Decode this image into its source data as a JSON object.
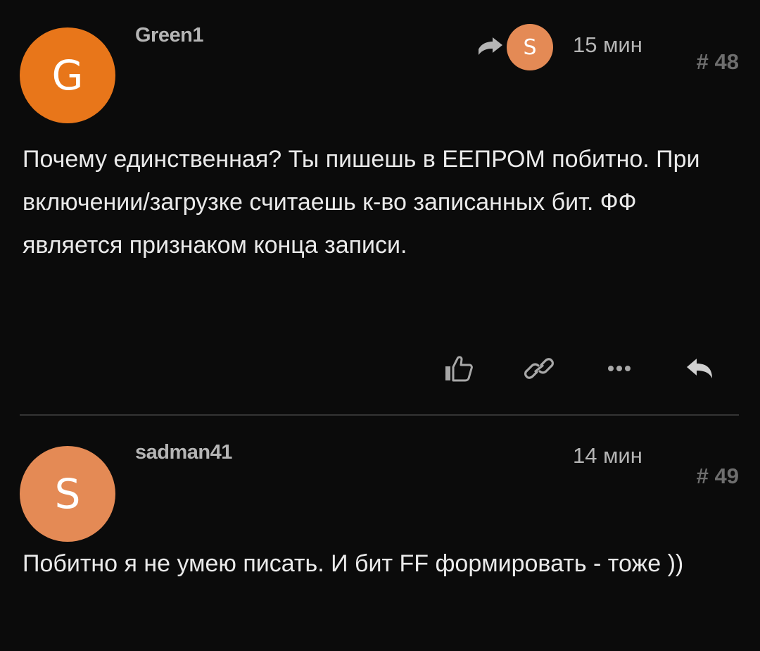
{
  "posts": [
    {
      "avatar_letter": "G",
      "avatar_color": "#e8761a",
      "username": "Green1",
      "reply_to_avatar_letter": "S",
      "time": "15 мин",
      "post_number": "# 48",
      "text": "Почему единственная? Ты пишешь в ЕЕПРОМ побитно. При включении/загрузке считаешь к-во записанных бит. ФФ является признаком конца записи.",
      "actions": [
        "like-icon",
        "link-icon",
        "more-icon",
        "reply-icon"
      ]
    },
    {
      "avatar_letter": "S",
      "avatar_color": "#e48a55",
      "username": "sadman41",
      "time": "14 мин",
      "post_number": "# 49",
      "text": "Побитно я не умею писать. И бит FF формировать - тоже ))"
    }
  ]
}
